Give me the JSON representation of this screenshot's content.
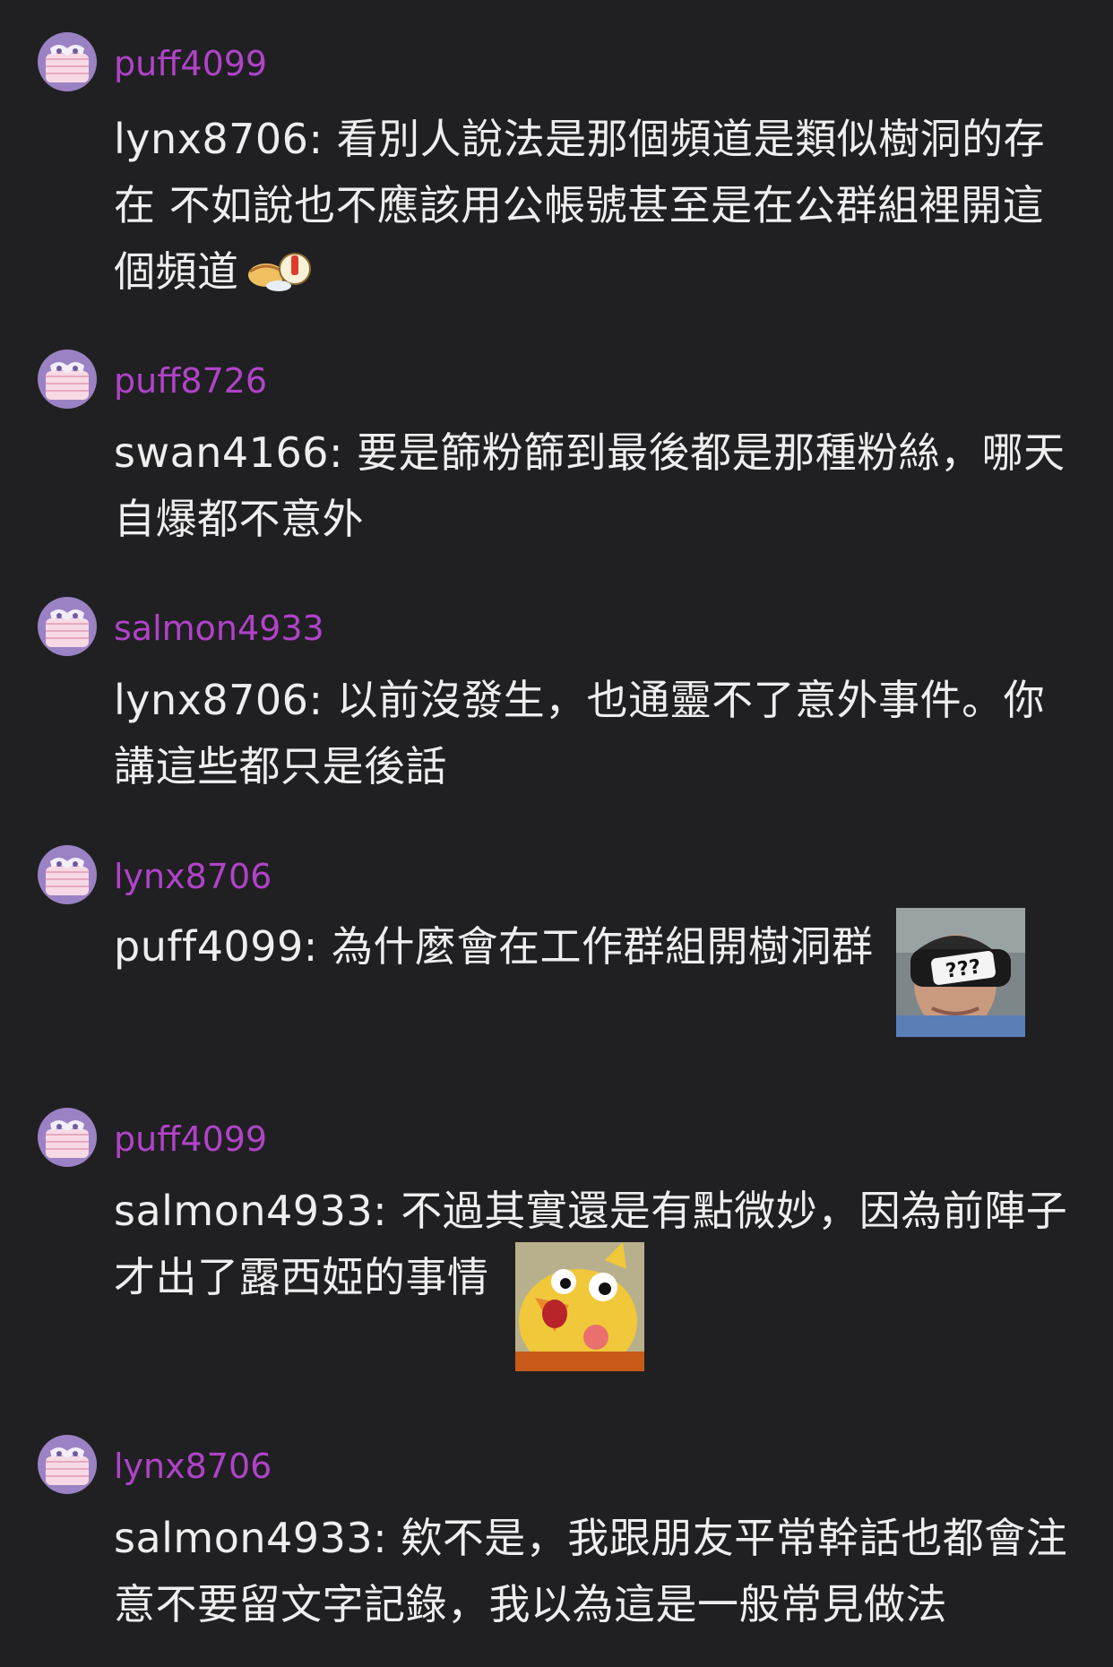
{
  "comments": [
    {
      "username": "puff4099",
      "reply_to": "lynx8706:",
      "text": "看別人說法是那個頻道是類似樹洞的存在 不如說也不應該用公帳號甚至是在公群組裡開這個頻道",
      "sticker": "inline-emoji-icon"
    },
    {
      "username": "puff8726",
      "reply_to": "swan4166:",
      "text": "要是篩粉篩到最後都是那種粉絲，哪天自爆都不意外"
    },
    {
      "username": "salmon4933",
      "reply_to": "lynx8706:",
      "text": "以前沒發生，也通靈不了意外事件。你講這些都只是後話"
    },
    {
      "username": "lynx8706",
      "reply_to": "puff4099:",
      "text": "為什麼會在工作群組開樹洞群",
      "sticker": "confused-vr-man-sticker",
      "sticker_caption": "???"
    },
    {
      "username": "puff4099",
      "reply_to": "salmon4933:",
      "text": "不過其實還是有點微妙，因為前陣子才出了露西婭的事情",
      "sticker": "shocked-chick-sticker"
    },
    {
      "username": "lynx8706",
      "reply_to": "salmon4933:",
      "text": "欸不是，我跟朋友平常幹話也都會注意不要留文字記錄，我以為這是一般常見做法"
    }
  ],
  "colors": {
    "background": "#202022",
    "username": "#b043c8",
    "text": "#eeeeee"
  }
}
